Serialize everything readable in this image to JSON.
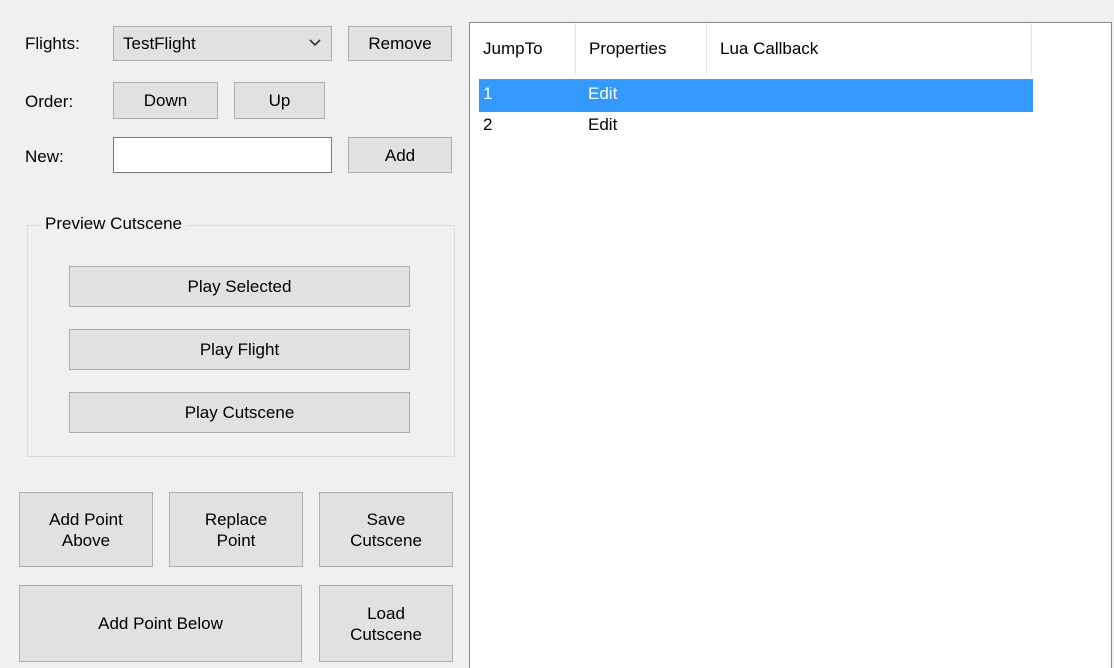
{
  "flights": {
    "label": "Flights:",
    "selected": "TestFlight",
    "remove_label": "Remove"
  },
  "order": {
    "label": "Order:",
    "down_label": "Down",
    "up_label": "Up"
  },
  "new_flight": {
    "label": "New:",
    "value": "",
    "add_label": "Add"
  },
  "preview": {
    "title": "Preview Cutscene",
    "play_selected": "Play Selected",
    "play_flight": "Play Flight",
    "play_cutscene": "Play Cutscene"
  },
  "actions": {
    "add_point_above": "Add Point\nAbove",
    "replace_point": "Replace\nPoint",
    "save_cutscene": "Save\nCutscene",
    "add_point_below": "Add Point Below",
    "load_cutscene": "Load\nCutscene"
  },
  "points_list": {
    "columns": [
      "JumpTo",
      "Properties",
      "Lua Callback"
    ],
    "rows": [
      {
        "jump_to": "1",
        "properties": "Edit",
        "lua_callback": "",
        "selected": true
      },
      {
        "jump_to": "2",
        "properties": "Edit",
        "lua_callback": "",
        "selected": false
      }
    ],
    "selection_color": "#3399ff"
  }
}
